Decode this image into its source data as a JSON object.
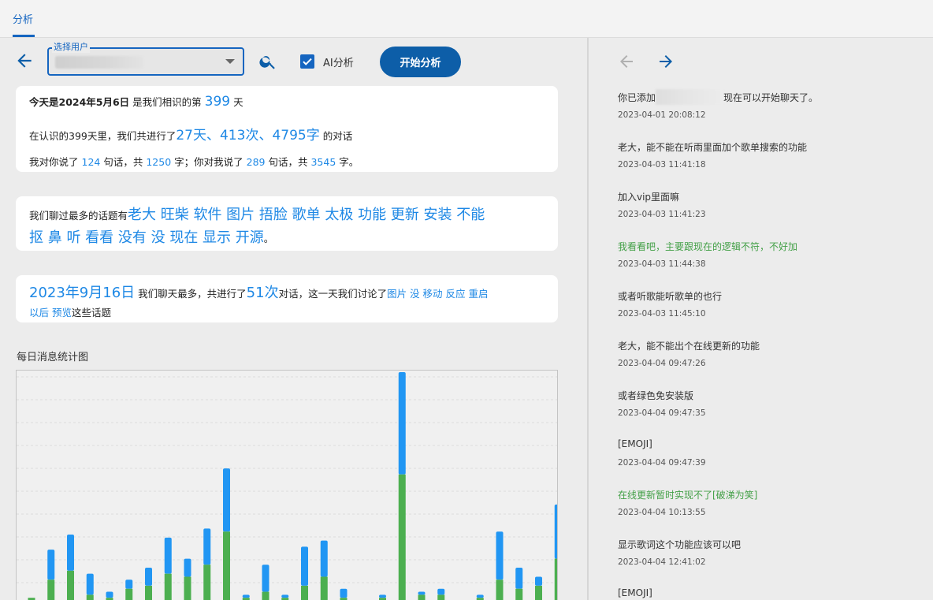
{
  "tab": {
    "label": "分析"
  },
  "controls": {
    "select_label": "选择用户",
    "checkbox_label": "AI分析",
    "checkbox_checked": true,
    "start_button": "开始分析"
  },
  "card1": {
    "line1_prefix": "今天是2024年5月6日",
    "line1_mid": "是我们相识的第",
    "line1_days": "399",
    "line1_suffix": "天",
    "line2_prefix": "在认识的399天里，我们共进行了",
    "line2_stats": "27天、413次、4795字",
    "line2_suffix": "的对话",
    "line3_a": "我对你说了",
    "line3_b": "124",
    "line3_c": "句话，共",
    "line3_d": "1250",
    "line3_e": "字；你对我说了",
    "line3_f": "289",
    "line3_g": "句话，共",
    "line3_h": "3545",
    "line3_i": "字。"
  },
  "card2": {
    "prefix": "我们聊过最多的话题有",
    "topics_line1": "老大 旺柴 软件 图片 捂脸 歌单 太极 功能 更新 安装 不能",
    "topics_line2": "抠 鼻 听 看看 没有 没 现在 显示 开源",
    "suffix": "。"
  },
  "card3": {
    "date": "2023年9月16日",
    "mid": "我们聊天最多，共进行了",
    "count": "51次",
    "mid2": "对话，这一天我们讨论了",
    "topics_line1": "图片 没 移动 反应 重启",
    "topics_line2": "以后 预览",
    "suffix": "这些话题"
  },
  "chart_title": "每日消息统计图",
  "chart_data": {
    "type": "bar",
    "stacked": true,
    "colors": {
      "mine": "#2196f3",
      "theirs": "#4caf50"
    },
    "series": [
      {
        "values": [
          1,
          7,
          10,
          2,
          1,
          4,
          5,
          9,
          8,
          12,
          23,
          1,
          3,
          1,
          5,
          8,
          1,
          0,
          1,
          42,
          2,
          2,
          0,
          1,
          7,
          4,
          5,
          14
        ]
      },
      {
        "values": [
          0,
          10,
          12,
          7,
          2,
          3,
          6,
          12,
          6,
          12,
          21,
          1,
          9,
          1,
          13,
          12,
          3,
          0,
          1,
          34,
          1,
          2,
          0,
          1,
          16,
          7,
          3,
          18
        ]
      }
    ]
  },
  "nav": {
    "prev": "←",
    "next": "→"
  },
  "messages": [
    {
      "pre": "你已添加",
      "post": "现在可以开始聊天了。",
      "time": "2023-04-01 20:08:12",
      "me": false,
      "redacted": true
    },
    {
      "text": "老大，能不能在听雨里面加个歌单搜索的功能",
      "time": "2023-04-03 11:41:18",
      "me": false
    },
    {
      "text": "加入vip里面嘛",
      "time": "2023-04-03 11:41:23",
      "me": false
    },
    {
      "text": "我看看吧，主要跟现在的逻辑不符，不好加",
      "time": "2023-04-03 11:44:38",
      "me": true
    },
    {
      "text": "或者听歌能听歌单的也行",
      "time": "2023-04-03 11:45:10",
      "me": false
    },
    {
      "text": "老大，能不能出个在线更新的功能",
      "time": "2023-04-04 09:47:26",
      "me": false
    },
    {
      "text": "或者绿色免安装版",
      "time": "2023-04-04 09:47:35",
      "me": false
    },
    {
      "text": "[EMOJI]",
      "time": "2023-04-04 09:47:39",
      "me": false
    },
    {
      "text": "在线更新暂时实现不了[破涕为笑]",
      "time": "2023-04-04 10:13:55",
      "me": true
    },
    {
      "text": "显示歌词这个功能应该可以吧",
      "time": "2023-04-04 12:41:02",
      "me": false
    },
    {
      "text": "[EMOJI]",
      "time": "",
      "me": false
    }
  ]
}
